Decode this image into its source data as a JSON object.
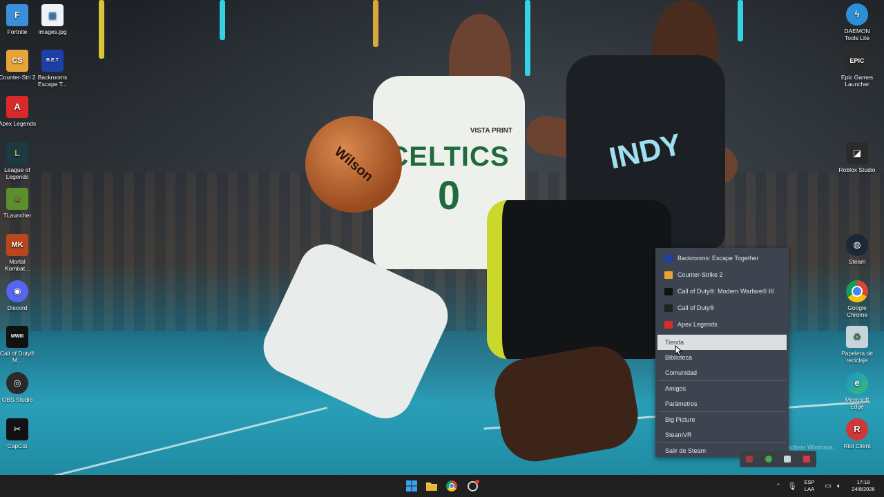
{
  "desktop": {
    "left_icons": [
      {
        "label": "Fortnite",
        "glyph": "F",
        "color": "#3b8fd9"
      },
      {
        "label": "images.jpg",
        "glyph": "▦",
        "color": "#eef3f8"
      },
      {
        "label": "Counter-Stri 2",
        "glyph": "CS",
        "color": "#e8a43b"
      },
      {
        "label": "Backrooms Escape T...",
        "glyph": "B.E.T",
        "color": "#1d3fa8"
      },
      {
        "label": "Apex Legends",
        "glyph": "A",
        "color": "#d92a2a"
      },
      {
        "label": "League of Legends",
        "glyph": "L",
        "color": "#1b3a44"
      },
      {
        "label": "TLauncher",
        "glyph": "■",
        "color": "#5a8f2e"
      },
      {
        "label": "Mortal Kombat...",
        "glyph": "MK",
        "color": "#b9461d"
      },
      {
        "label": "Discord",
        "glyph": "◉",
        "color": "#5865f2"
      },
      {
        "label": "Call of Duty® M...",
        "glyph": "MWIII",
        "color": "#111111"
      },
      {
        "label": "OBS Studio",
        "glyph": "◎",
        "color": "#2a2a2a"
      },
      {
        "label": "CapCut",
        "glyph": "✂",
        "color": "#111111"
      }
    ],
    "right_icons": [
      {
        "label": "DAEMON Tools Lite",
        "glyph": "ϟ",
        "color": "#2d8fd6"
      },
      {
        "label": "Epic Games Launcher",
        "glyph": "EPIC",
        "color": "#2b2b2b"
      },
      {
        "label": "Roblox Studio",
        "glyph": "◪",
        "color": "#2b2b2b"
      },
      {
        "label": "Steam",
        "glyph": "◍",
        "color": "#1b2838"
      },
      {
        "label": "Google Chrome",
        "glyph": "◉",
        "color": "#e0e0e0"
      },
      {
        "label": "Papelera de reciclaje",
        "glyph": "♻",
        "color": "#c7d4dc"
      },
      {
        "label": "Microsoft Edge",
        "glyph": "e",
        "color": "#1a8f6e"
      },
      {
        "label": "Riot Client",
        "glyph": "R",
        "color": "#d13639"
      }
    ]
  },
  "steam_menu": {
    "recent_games": [
      {
        "label": "Backrooms: Escape Together",
        "icon_color": "#1d3fa8"
      },
      {
        "label": "Counter-Strike 2",
        "icon_color": "#e8a43b"
      },
      {
        "label": "Call of Duty®: Modern Warfare® III",
        "icon_color": "#111111"
      },
      {
        "label": "Call of Duty®",
        "icon_color": "#222222"
      },
      {
        "label": "Apex Legends",
        "icon_color": "#d92a2a"
      }
    ],
    "items": [
      {
        "label": "Tienda",
        "highlighted": true
      },
      {
        "label": "Biblioteca",
        "highlighted": false
      },
      {
        "label": "Comunidad",
        "highlighted": false
      },
      {
        "label": "Amigos",
        "highlighted": false
      },
      {
        "label": "Parámetros",
        "highlighted": false
      },
      {
        "label": "Big Picture",
        "highlighted": false
      },
      {
        "label": "SteamVR",
        "highlighted": false
      },
      {
        "label": "Salir de Steam",
        "highlighted": false
      }
    ]
  },
  "watermark": {
    "line1": "Activar Windows",
    "line2": "Ve a Configuración para activar Windows."
  },
  "wallpaper": {
    "jersey_text": "CELTICS",
    "jersey_number": "0",
    "sponsor": "VISTA PRINT",
    "opponent_text": "INDY",
    "ball_text": "Wilson"
  },
  "taskbar": {
    "language": "ESP",
    "region": "LAA",
    "time": "17:18",
    "date": "24/8/2026"
  }
}
